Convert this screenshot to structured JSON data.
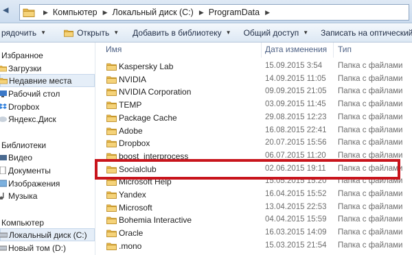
{
  "address_bar": {
    "crumbs": [
      "Компьютер",
      "Локальный диск (C:)",
      "ProgramData"
    ]
  },
  "toolbar": {
    "organize": "рядочить",
    "open": "Открыть",
    "add_to_library": "Добавить в библиотеку",
    "share": "Общий доступ",
    "burn": "Записать на оптический диск"
  },
  "nav": {
    "favorites": {
      "title": "Избранное",
      "items": [
        "Загрузки",
        "Недавние места",
        "Рабочий стол",
        "Dropbox",
        "Яндекс.Диск"
      ]
    },
    "libraries": {
      "title": "Библиотеки",
      "items": [
        "Видео",
        "Документы",
        "Изображения",
        "Музыка"
      ]
    },
    "computer": {
      "title": "Компьютер",
      "items": [
        "Локальный диск (C:)",
        "Новый том (D:)"
      ]
    }
  },
  "file_list": {
    "columns": [
      "Имя",
      "Дата изменения",
      "Тип"
    ],
    "rows": [
      {
        "name": "Kaspersky Lab",
        "date": "15.09.2015 3:54",
        "type": "Папка с файлами"
      },
      {
        "name": "NVIDIA",
        "date": "14.09.2015 11:05",
        "type": "Папка с файлами"
      },
      {
        "name": "NVIDIA Corporation",
        "date": "09.09.2015 21:05",
        "type": "Папка с файлами"
      },
      {
        "name": "TEMP",
        "date": "03.09.2015 11:45",
        "type": "Папка с файлами"
      },
      {
        "name": "Package Cache",
        "date": "29.08.2015 12:23",
        "type": "Папка с файлами"
      },
      {
        "name": "Adobe",
        "date": "16.08.2015 22:41",
        "type": "Папка с файлами"
      },
      {
        "name": "Dropbox",
        "date": "20.07.2015 15:56",
        "type": "Папка с файлами"
      },
      {
        "name": "boost_interprocess",
        "date": "06.07.2015 11:20",
        "type": "Папка с файлами"
      },
      {
        "name": "Socialclub",
        "date": "02.06.2015 19:11",
        "type": "Папка с файлами"
      },
      {
        "name": "Microsoft Help",
        "date": "15.05.2015 15:20",
        "type": "Папка с файлами"
      },
      {
        "name": "Yandex",
        "date": "16.04.2015 15:52",
        "type": "Папка с файлами"
      },
      {
        "name": "Microsoft",
        "date": "13.04.2015 22:53",
        "type": "Папка с файлами"
      },
      {
        "name": "Bohemia Interactive",
        "date": "04.04.2015 15:59",
        "type": "Папка с файлами"
      },
      {
        "name": "Oracle",
        "date": "16.03.2015 14:09",
        "type": "Папка с файлами"
      },
      {
        "name": ".mono",
        "date": "15.03.2015 21:54",
        "type": "Папка с файлами"
      }
    ]
  },
  "highlight": {
    "row_name": "Socialclub",
    "color": "#c8141c"
  },
  "colors": {
    "folder": "#e8b84a",
    "accent": "#4d6185"
  }
}
